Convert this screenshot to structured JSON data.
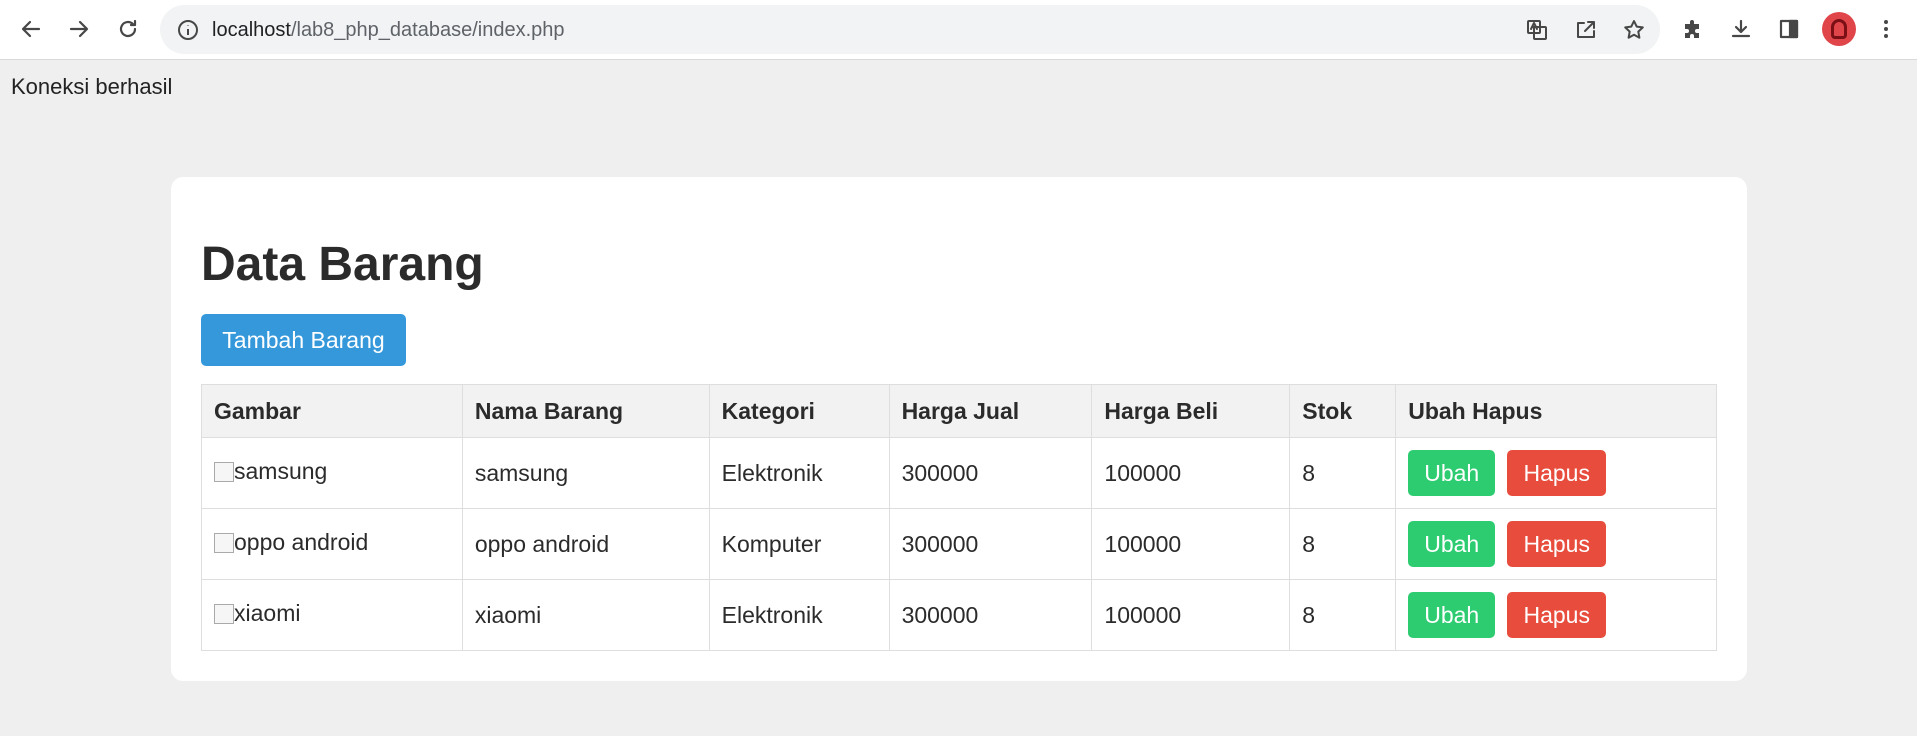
{
  "browser": {
    "url_host": "localhost",
    "url_path": "/lab8_php_database/index.php",
    "icons": [
      "back-icon",
      "forward-icon",
      "reload-icon",
      "site-info-icon",
      "translate-icon",
      "share-icon",
      "star-icon",
      "extensions-icon",
      "download-icon",
      "sidepanel-icon",
      "profile-avatar",
      "menu-icon"
    ]
  },
  "page": {
    "connection_message": "Koneksi berhasil",
    "title": "Data Barang",
    "add_button": "Tambah Barang"
  },
  "table": {
    "headers": [
      "Gambar",
      "Nama Barang",
      "Kategori",
      "Harga Jual",
      "Harga Beli",
      "Stok",
      "Ubah Hapus"
    ],
    "rows": [
      {
        "image_alt": "samsung",
        "name": "samsung",
        "category": "Elektronik",
        "sell_price": "300000",
        "buy_price": "100000",
        "stock": "8",
        "edit": "Ubah",
        "delete": "Hapus"
      },
      {
        "image_alt": "oppo android",
        "name": "oppo android",
        "category": "Komputer",
        "sell_price": "300000",
        "buy_price": "100000",
        "stock": "8",
        "edit": "Ubah",
        "delete": "Hapus"
      },
      {
        "image_alt": "xiaomi",
        "name": "xiaomi",
        "category": "Elektronik",
        "sell_price": "300000",
        "buy_price": "100000",
        "stock": "8",
        "edit": "Ubah",
        "delete": "Hapus"
      }
    ]
  },
  "colors": {
    "primary_button": "#3498db",
    "edit_button": "#2ecc71",
    "delete_button": "#e74c3c",
    "background": "#efefef"
  }
}
